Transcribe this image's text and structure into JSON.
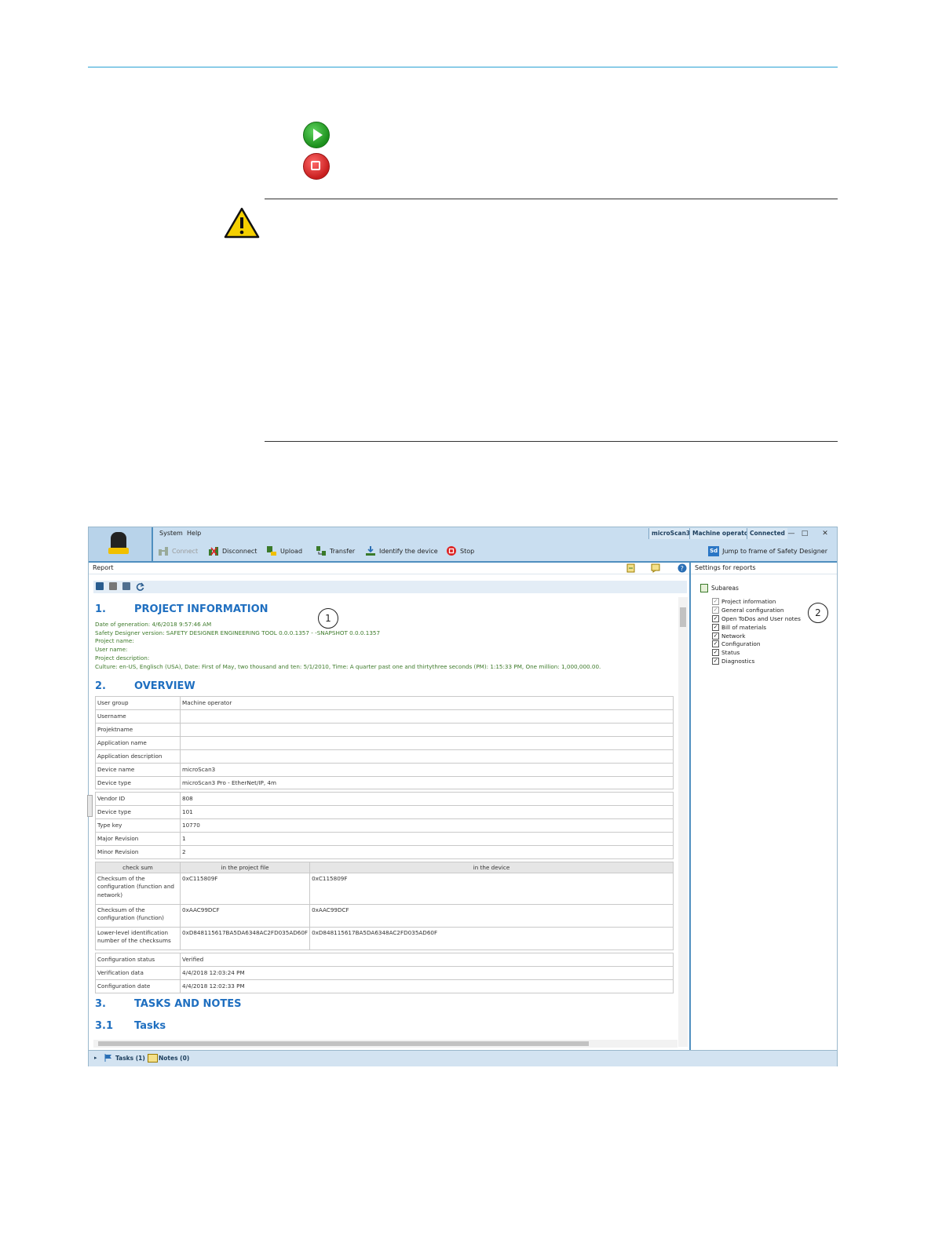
{
  "app": {
    "menu": [
      "System",
      "Help"
    ],
    "toolbar": [
      {
        "label": "Connect",
        "icon": "connect-icon",
        "enabled": false
      },
      {
        "label": "Disconnect",
        "icon": "disconnect-icon",
        "enabled": true
      },
      {
        "label": "Upload",
        "icon": "upload-icon",
        "enabled": true
      },
      {
        "label": "Transfer",
        "icon": "transfer-icon",
        "enabled": true
      },
      {
        "label": "Identify the device",
        "icon": "identify-icon",
        "enabled": true
      },
      {
        "label": "Stop",
        "icon": "stop-icon",
        "enabled": true
      }
    ],
    "status": {
      "device": "microScan3",
      "user": "Machine operator",
      "connection": "Connected"
    },
    "jump_label": "Jump to frame of Safety Designer",
    "jump_icon_text": "Sd",
    "report_pane_title": "Report",
    "settings_pane_title": "Settings for reports"
  },
  "report": {
    "section1": {
      "num": "1.",
      "title": "PROJECT INFORMATION"
    },
    "meta": [
      "Date of generation: 4/6/2018 9:57:46 AM",
      "Safety Designer version: SAFETY DESIGNER ENGINEERING TOOL 0.0.0.1357 - -SNAPSHOT 0.0.0.1357",
      "Project name:",
      "User name:",
      "Project description:",
      "Culture: en-US, Englisch (USA), Date: First of May, two thousand and ten: 5/1/2010, Time: A quarter past one and thirtythree seconds (PM): 1:15:33 PM, One million: 1,000,000.00."
    ],
    "section2": {
      "num": "2.",
      "title": "OVERVIEW"
    },
    "overview": [
      [
        "User group",
        "Machine operator"
      ],
      [
        "Username",
        ""
      ],
      [
        "Projektname",
        ""
      ],
      [
        "Application name",
        ""
      ],
      [
        "Application description",
        ""
      ],
      [
        "Device name",
        "microScan3"
      ],
      [
        "Device type",
        "microScan3 Pro - EtherNet/IP, 4m"
      ]
    ],
    "ids": [
      [
        "Vendor ID",
        "808"
      ],
      [
        "Device type",
        "101"
      ],
      [
        "Type key",
        "10770"
      ],
      [
        "Major Revision",
        "1"
      ],
      [
        "Minor Revision",
        "2"
      ]
    ],
    "checksum_headers": [
      "check sum",
      "in the project file",
      "in the device"
    ],
    "checksums": [
      [
        "Checksum of the configuration (function and network)",
        "0xC115809F",
        "0xC115809F"
      ],
      [
        "Checksum of the configuration (function)",
        "0xAAC99DCF",
        "0xAAC99DCF"
      ],
      [
        "Lower-level identification number of the checksums",
        "0xD848115617BA5DA6348AC2FD035AD60F",
        "0xD848115617BA5DA6348AC2FD035AD60F"
      ]
    ],
    "verification": [
      [
        "Configuration status",
        "Verified"
      ],
      [
        "Verification data",
        "4/4/2018 12:03:24 PM"
      ],
      [
        "Configuration date",
        "4/4/2018 12:02:33 PM"
      ]
    ],
    "section3": {
      "num": "3.",
      "title": "TASKS AND NOTES"
    },
    "section31": {
      "num": "3.1",
      "title": "Tasks"
    }
  },
  "settings": {
    "group": "Subareas",
    "items": [
      {
        "label": "Project information",
        "checked": true,
        "locked": true
      },
      {
        "label": "General configuration",
        "checked": true,
        "locked": true
      },
      {
        "label": "Open ToDos and User notes",
        "checked": true,
        "locked": false
      },
      {
        "label": "Bill of materials",
        "checked": true,
        "locked": false
      },
      {
        "label": "Network",
        "checked": true,
        "locked": false
      },
      {
        "label": "Configuration",
        "checked": true,
        "locked": false
      },
      {
        "label": "Status",
        "checked": true,
        "locked": false
      },
      {
        "label": "Diagnostics",
        "checked": true,
        "locked": false
      }
    ]
  },
  "statusbar": {
    "tasks": "Tasks (1)",
    "notes": "Notes (0)"
  },
  "callouts": [
    "1",
    "2"
  ]
}
